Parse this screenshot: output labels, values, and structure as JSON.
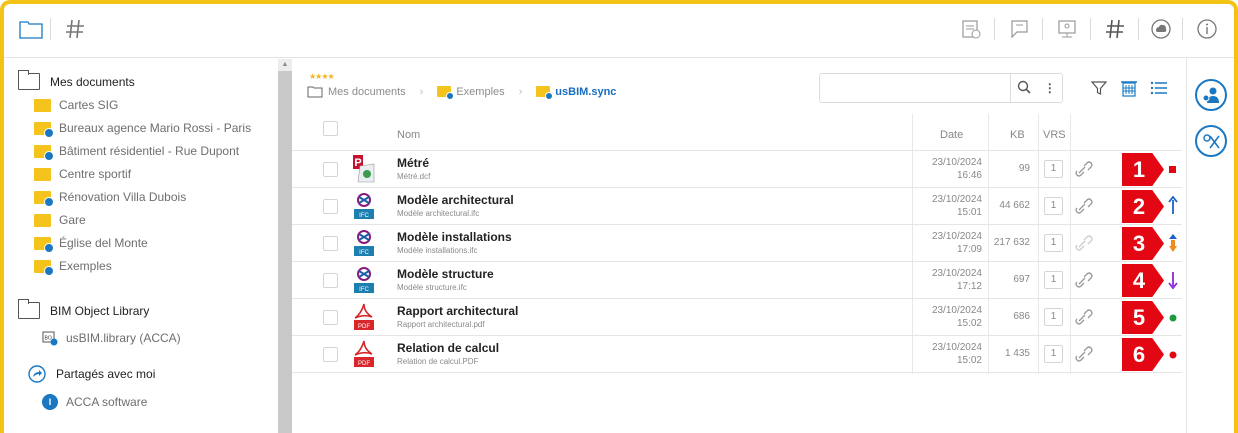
{
  "topbar": {
    "left_icons": [
      "folder-icon",
      "hashtag-icon"
    ],
    "right_icons": [
      "calendar-icon",
      "chat-icon",
      "presentation-icon",
      "hashtag-icon",
      "cloud-icon",
      "info-icon"
    ]
  },
  "sidebar": {
    "mes_documents": {
      "label": "Mes documents",
      "items": [
        {
          "label": "Cartes SIG",
          "sync": false
        },
        {
          "label": "Bureaux agence Mario Rossi - Paris",
          "sync": true
        },
        {
          "label": "Bâtiment résidentiel - Rue Dupont",
          "sync": true
        },
        {
          "label": "Centre sportif",
          "sync": false
        },
        {
          "label": "Rénovation Villa Dubois",
          "sync": true
        },
        {
          "label": "Gare",
          "sync": false
        },
        {
          "label": "Église del Monte",
          "sync": true
        },
        {
          "label": "Exemples",
          "sync": true
        }
      ]
    },
    "bim_library": {
      "label": "BIM Object Library",
      "items": [
        {
          "label": "usBIM.library (ACCA)"
        }
      ]
    },
    "shared": {
      "label": "Partagés avec moi",
      "items": [
        {
          "label": "ACCA software"
        }
      ]
    }
  },
  "breadcrumb": {
    "stars": "★★★★",
    "items": [
      "Mes documents",
      "Exemples",
      "usBIM.sync"
    ]
  },
  "search": {
    "placeholder": ""
  },
  "table": {
    "headers": {
      "name": "Nom",
      "date": "Date",
      "kb": "KB",
      "vrs": "VRS"
    },
    "rows": [
      {
        "name": "Métré",
        "file": "Métré.dcf",
        "date": "23/10/2024",
        "time": "16:46",
        "kb": "99",
        "vrs": "1",
        "type": "dcf",
        "marker": "1",
        "status": "red-square"
      },
      {
        "name": "Modèle architectural",
        "file": "Modèle architectural.ifc",
        "date": "23/10/2024",
        "time": "15:01",
        "kb": "44 662",
        "vrs": "1",
        "type": "ifc",
        "marker": "2",
        "status": "blue-up-arrow"
      },
      {
        "name": "Modèle installations",
        "file": "Modèle installations.ifc",
        "date": "23/10/2024",
        "time": "17:09",
        "kb": "217 632",
        "vrs": "1",
        "type": "ifc",
        "marker": "3",
        "status": "orange-blue-arrows"
      },
      {
        "name": "Modèle structure",
        "file": "Modèle structure.ifc",
        "date": "23/10/2024",
        "time": "17:12",
        "kb": "697",
        "vrs": "1",
        "type": "ifc",
        "marker": "4",
        "status": "purple-down-arrow"
      },
      {
        "name": "Rapport architectural",
        "file": "Rapport architectural.pdf",
        "date": "23/10/2024",
        "time": "15:02",
        "kb": "686",
        "vrs": "1",
        "type": "pdf",
        "marker": "5",
        "status": "green-dot"
      },
      {
        "name": "Relation de calcul",
        "file": "Relation de calcul.PDF",
        "date": "23/10/2024",
        "time": "15:02",
        "kb": "1 435",
        "vrs": "1",
        "type": "pdf",
        "marker": "6",
        "status": "red-dot"
      }
    ]
  },
  "badges": {
    "ifc": "IFC",
    "pdf": "PDF"
  },
  "colors": {
    "accent": "#1a78c2",
    "frame": "#f2c314",
    "marker": "#e30613",
    "folder": "#f4c41c"
  }
}
